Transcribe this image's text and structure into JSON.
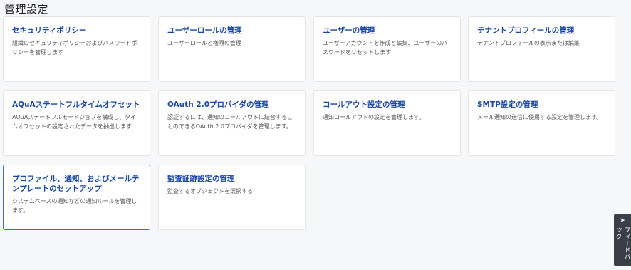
{
  "page": {
    "title": "管理設定"
  },
  "cards": [
    {
      "title": "セキュリティポリシー",
      "desc": "組織のセキュリティポリシーおよびパスワードポリシーを管理します"
    },
    {
      "title": "ユーザーロールの管理",
      "desc": "ユーザーロールと権限の管理"
    },
    {
      "title": "ユーザーの管理",
      "desc": "ユーザーアカウントを作成と編集、ユーザーのパスワードをリセットします"
    },
    {
      "title": "テナントプロフィールの管理",
      "desc": "テナントプロフィールの表示または編集"
    },
    {
      "title": "AQuAステートフルタイムオフセット",
      "desc": "AQuAステートフルモードジョブを構成し、タイムオフセットの設定されたデータを抽出します"
    },
    {
      "title": "OAuth 2.0プロバイダの管理",
      "desc": "認証するには、通知のコールアウトに結合することのできるOAuth 2.0プロバイダを管理します。"
    },
    {
      "title": "コールアウト設定の管理",
      "desc": "通知コールアウトの設定を管理します。"
    },
    {
      "title": "SMTP設定の管理",
      "desc": "メール通知の送信に使用する設定を管理します。"
    },
    {
      "title": "プロファイル、通知、およびメールテンプレートのセットアップ",
      "desc": "システムベースの通知などの通知ルールを管理します。"
    },
    {
      "title": "監査証跡設定の管理",
      "desc": "監査するオブジェクトを選択する"
    }
  ],
  "feedback": {
    "label": "フィードバック",
    "icon": "cursor-arrow-icon"
  },
  "colors": {
    "link": "#1a47a6",
    "selected_border": "#3b6fd4",
    "background": "#f6f7f9"
  }
}
